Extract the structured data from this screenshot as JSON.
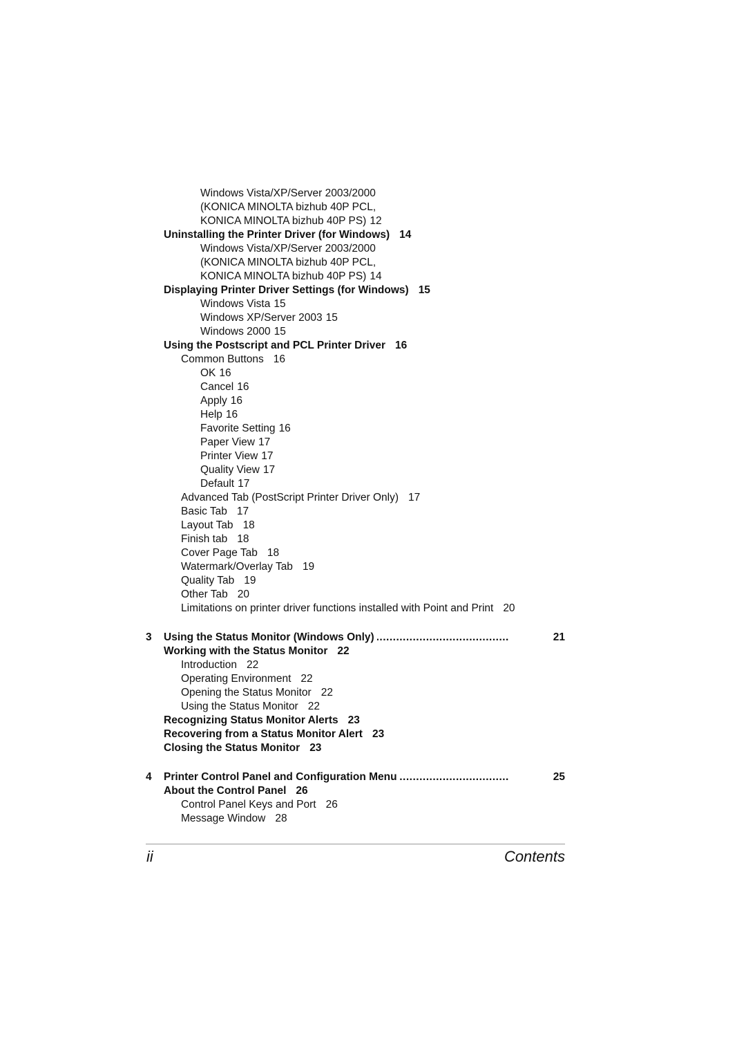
{
  "section_a": [
    {
      "level": 3,
      "text": "Windows Vista/XP/Server 2003/2000",
      "page": ""
    },
    {
      "level": 3,
      "text": "(KONICA MINOLTA bizhub 40P PCL,",
      "page": ""
    },
    {
      "level": 3,
      "text": "KONICA MINOLTA bizhub 40P PS)",
      "page": "12"
    },
    {
      "level": 1,
      "text": "Uninstalling the Printer Driver (for Windows)",
      "page": "14"
    },
    {
      "level": 3,
      "text": "Windows Vista/XP/Server 2003/2000",
      "page": ""
    },
    {
      "level": 3,
      "text": "(KONICA MINOLTA bizhub 40P PCL,",
      "page": ""
    },
    {
      "level": 3,
      "text": "KONICA MINOLTA bizhub 40P PS)",
      "page": "14"
    },
    {
      "level": 1,
      "text": "Displaying Printer Driver Settings (for Windows)",
      "page": "15"
    },
    {
      "level": 3,
      "text": "Windows Vista",
      "page": "15"
    },
    {
      "level": 3,
      "text": "Windows XP/Server 2003",
      "page": "15"
    },
    {
      "level": 3,
      "text": "Windows 2000",
      "page": "15"
    },
    {
      "level": 1,
      "text": "Using the Postscript and PCL Printer Driver",
      "page": "16"
    },
    {
      "level": 2,
      "text": "Common Buttons",
      "page": "16"
    },
    {
      "level": 3,
      "text": "OK",
      "page": "16"
    },
    {
      "level": 3,
      "text": "Cancel",
      "page": "16"
    },
    {
      "level": 3,
      "text": "Apply",
      "page": "16"
    },
    {
      "level": 3,
      "text": "Help",
      "page": "16"
    },
    {
      "level": 3,
      "text": "Favorite Setting",
      "page": "16"
    },
    {
      "level": 3,
      "text": "Paper View",
      "page": "17"
    },
    {
      "level": 3,
      "text": "Printer View",
      "page": "17"
    },
    {
      "level": 3,
      "text": "Quality View",
      "page": "17"
    },
    {
      "level": 3,
      "text": "Default",
      "page": "17"
    },
    {
      "level": 2,
      "text": "Advanced Tab (PostScript Printer Driver Only)",
      "page": "17"
    },
    {
      "level": 2,
      "text": "Basic Tab",
      "page": "17"
    },
    {
      "level": 2,
      "text": "Layout Tab",
      "page": "18"
    },
    {
      "level": 2,
      "text": "Finish tab",
      "page": "18"
    },
    {
      "level": 2,
      "text": "Cover Page Tab",
      "page": "18"
    },
    {
      "level": 2,
      "text": "Watermark/Overlay Tab",
      "page": "19"
    },
    {
      "level": 2,
      "text": "Quality Tab",
      "page": "19"
    },
    {
      "level": 2,
      "text": "Other Tab",
      "page": "20"
    },
    {
      "level": 2,
      "text": "Limitations on printer driver functions installed with Point and Print",
      "page": "20"
    }
  ],
  "chapter3": {
    "number": "3",
    "title": "Using the Status Monitor (Windows Only)",
    "dots": "........................................................................................................",
    "page": "21",
    "entries": [
      {
        "level": 1,
        "text": "Working with the Status Monitor",
        "page": "22"
      },
      {
        "level": 2,
        "text": "Introduction",
        "page": "22"
      },
      {
        "level": 2,
        "text": "Operating Environment",
        "page": "22"
      },
      {
        "level": 2,
        "text": "Opening the Status Monitor",
        "page": "22"
      },
      {
        "level": 2,
        "text": "Using the Status Monitor",
        "page": "22"
      },
      {
        "level": 1,
        "text": "Recognizing Status Monitor Alerts",
        "page": "23"
      },
      {
        "level": 1,
        "text": "Recovering from a Status Monitor Alert",
        "page": "23"
      },
      {
        "level": 1,
        "text": "Closing the Status Monitor",
        "page": "23"
      }
    ]
  },
  "chapter4": {
    "number": "4",
    "title": "Printer Control Panel and Configuration Menu",
    "dots": "........................................................................................................",
    "page": "25",
    "entries": [
      {
        "level": 1,
        "text": "About the Control Panel",
        "page": "26"
      },
      {
        "level": 2,
        "text": "Control Panel Keys and Port",
        "page": "26"
      },
      {
        "level": 2,
        "text": "Message Window",
        "page": "28"
      }
    ]
  },
  "footer": {
    "page_number": "ii",
    "section": "Contents"
  }
}
